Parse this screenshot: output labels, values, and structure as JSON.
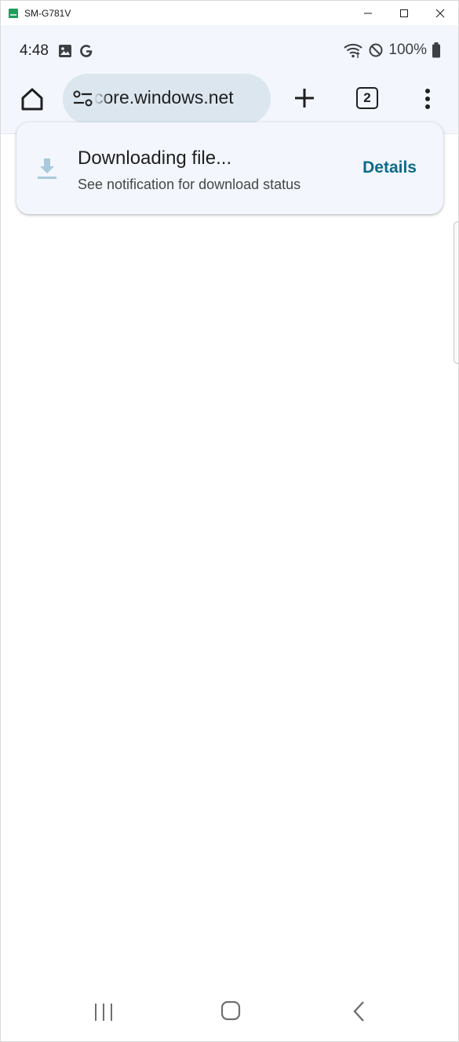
{
  "window": {
    "title": "SM-G781V",
    "controls": [
      "minimize-icon",
      "maximize-icon",
      "close-icon"
    ]
  },
  "status_bar": {
    "time": "4:48",
    "left_icons": [
      "image-icon",
      "google-g-icon"
    ],
    "right_icons": [
      "wifi-icon",
      "do-not-disturb-icon",
      "battery-icon"
    ],
    "battery_percent": "100%"
  },
  "toolbar": {
    "home_icon": "home-icon",
    "url": "core.windows.net",
    "site_settings_icon": "tune-icon",
    "new_tab_icon": "plus-icon",
    "tab_count": "2",
    "menu_icon": "more-vert-icon"
  },
  "message": {
    "icon": "download-icon",
    "title": "Downloading file...",
    "subtitle": "See notification for download status",
    "action_label": "Details",
    "accent_color": "#0b6b8a"
  },
  "nav_bar": {
    "buttons": [
      "recents-icon",
      "home-icon",
      "back-icon"
    ]
  }
}
